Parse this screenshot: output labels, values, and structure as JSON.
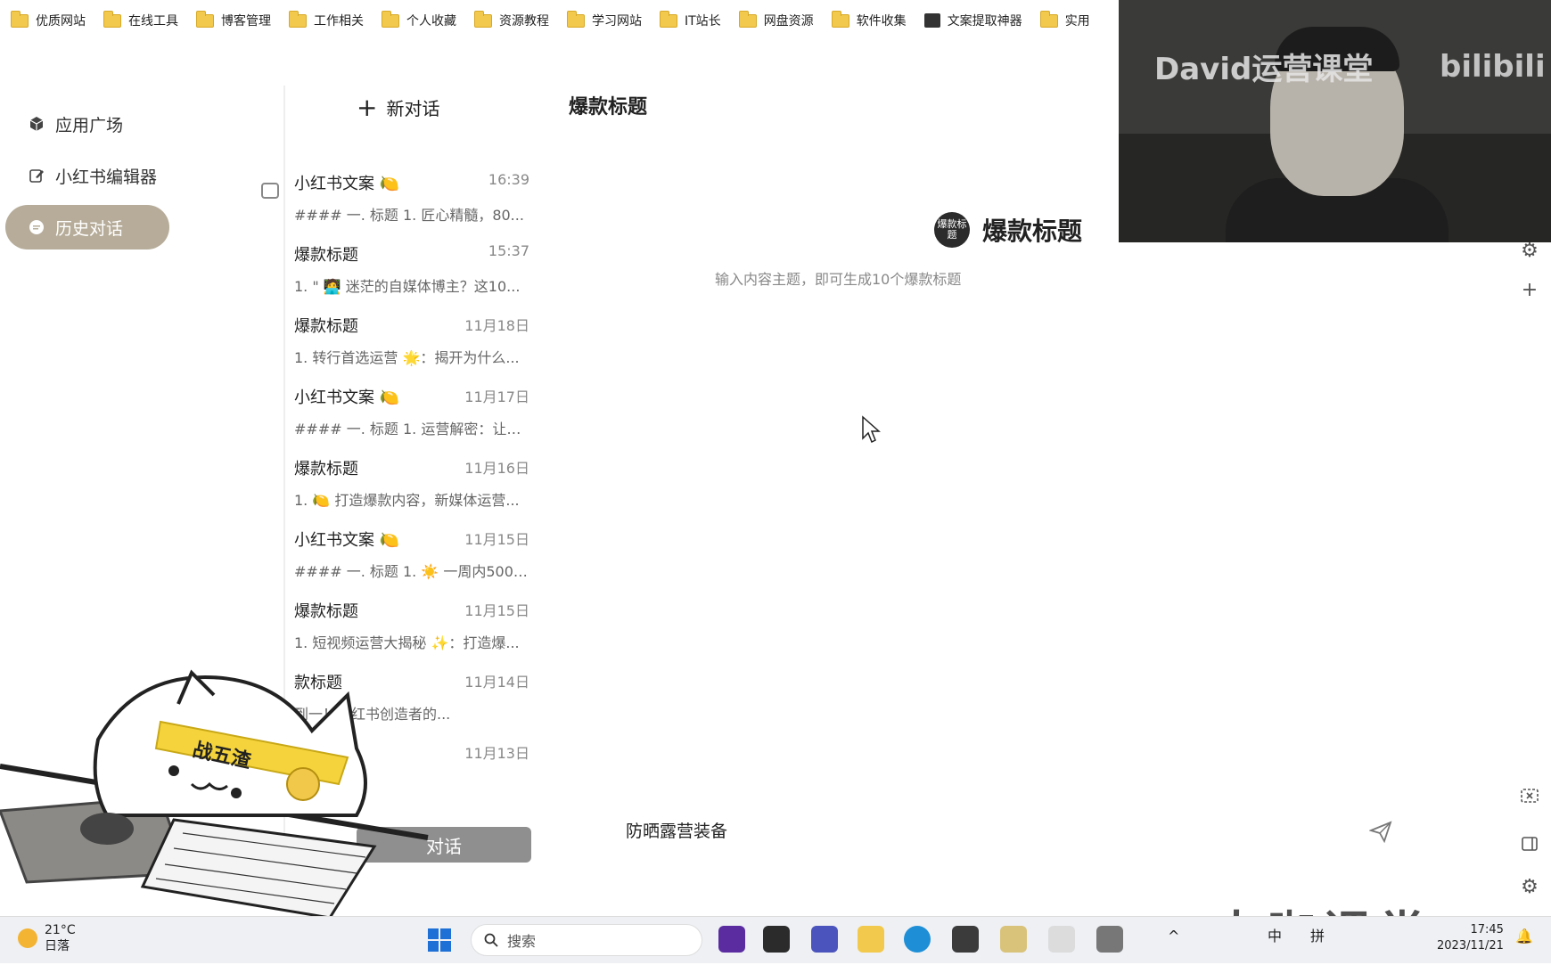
{
  "bookmarks": [
    {
      "label": "优质网站",
      "icon": "folder-icon"
    },
    {
      "label": "在线工具",
      "icon": "folder-icon"
    },
    {
      "label": "博客管理",
      "icon": "folder-icon"
    },
    {
      "label": "工作相关",
      "icon": "folder-icon"
    },
    {
      "label": "个人收藏",
      "icon": "folder-icon"
    },
    {
      "label": "资源教程",
      "icon": "folder-icon"
    },
    {
      "label": "学习网站",
      "icon": "folder-icon"
    },
    {
      "label": "IT站长",
      "icon": "folder-icon"
    },
    {
      "label": "网盘资源",
      "icon": "folder-icon"
    },
    {
      "label": "软件收集",
      "icon": "folder-icon"
    },
    {
      "label": "文案提取神器",
      "icon": "app-icon"
    },
    {
      "label": "实用",
      "icon": "folder-icon"
    }
  ],
  "sidebar": {
    "items": [
      {
        "label": "应用广场",
        "icon": "cube-icon"
      },
      {
        "label": "小红书编辑器",
        "icon": "edit-icon"
      },
      {
        "label": "历史对话",
        "icon": "chat-icon",
        "active": true
      }
    ]
  },
  "conversations": {
    "new_chat_label": "新对话",
    "items": [
      {
        "title": "小红书文案",
        "emoji": "🍋",
        "time": "16:39",
        "preview": "#### 一. 标题 1. 匠心精髓，80..."
      },
      {
        "title": "爆款标题",
        "emoji": "",
        "time": "15:37",
        "preview": "1. \" 🧑‍💻 迷茫的自媒体博主？这10..."
      },
      {
        "title": "爆款标题",
        "emoji": "",
        "time": "11月18日",
        "preview": "1. 转行首选运营 🌟：揭开为什么..."
      },
      {
        "title": "小红书文案",
        "emoji": "🍋",
        "time": "11月17日",
        "preview": "#### 一. 标题 1. 运营解密：让你..."
      },
      {
        "title": "爆款标题",
        "emoji": "",
        "time": "11月16日",
        "preview": "1. 🍋 打造爆款内容，新媒体运营..."
      },
      {
        "title": "小红书文案",
        "emoji": "🍋",
        "time": "11月15日",
        "preview": "#### 一. 标题 1. ☀️ 一周内5000..."
      },
      {
        "title": "爆款标题",
        "emoji": "",
        "time": "11月15日",
        "preview": "1. 短视频运营大揭秘 ✨：打造爆..."
      },
      {
        "title": "款标题",
        "emoji": "",
        "time": "11月14日",
        "preview": "到一！小红书创造者的..."
      },
      {
        "title": "",
        "emoji": "",
        "time": "11月13日",
        "preview": ""
      }
    ],
    "bottom_button_label": "对话"
  },
  "main": {
    "page_title": "爆款标题",
    "bot_avatar_text": "爆款标题",
    "bot_name": "爆款标题",
    "bot_description": "输入内容主题，即可生成10个爆款标题",
    "input_value": "防晒露营装备"
  },
  "overlays": {
    "webcam_watermark": "David运营课堂",
    "webcam_logo": "bilibili",
    "cat_banner": "战五渣",
    "bottom_watermark": "大咖课堂"
  },
  "taskbar": {
    "weather_temp": "21°C",
    "weather_desc": "日落",
    "search_label": "搜索",
    "ime_mode": "中",
    "ime_input": "拼",
    "time": "17:45",
    "date": "2023/11/21"
  },
  "colors": {
    "active_nav": "#b6ac99",
    "taskbar_bg": "#eef0f4",
    "folder": "#f2c94c"
  }
}
